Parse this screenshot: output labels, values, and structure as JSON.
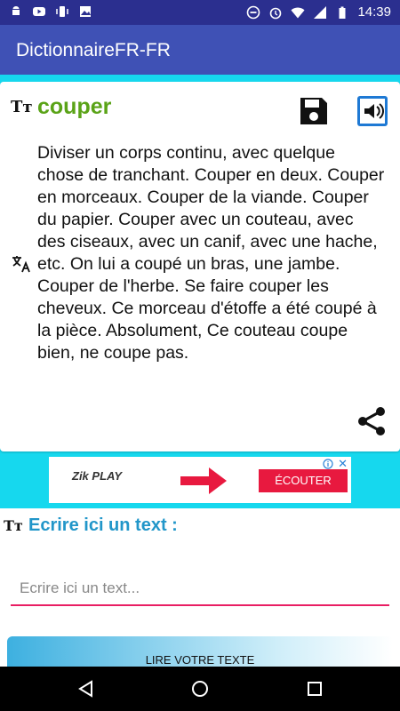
{
  "status_bar": {
    "time": "14:39",
    "left_icons": [
      "android-icon",
      "youtube-icon",
      "vibrate-icon",
      "image-icon"
    ],
    "right_icons": [
      "minus-circle-icon",
      "alarm-icon",
      "wifi-icon",
      "signal-icon",
      "battery-icon"
    ]
  },
  "app_bar": {
    "title": "DictionnaireFR-FR"
  },
  "entry": {
    "word": "couper",
    "definition": "Diviser un corps continu, avec quelque chose de tranchant. Couper en deux. Couper en morceaux. Couper de la viande. Couper du papier. Couper avec un couteau, avec des ciseaux, avec un canif, avec une hache, etc. On lui a coupé un bras, une jambe. Couper de l'herbe. Se faire couper les cheveux. Ce morceau d'étoffe a été coupé à la pièce. Absolument, Ce couteau coupe bien, ne coupe pas."
  },
  "ad": {
    "logo": "Zik PLAY",
    "button": "ÉCOUTER",
    "close": "✕"
  },
  "composer": {
    "label": "Ecrire ici un text :",
    "placeholder": "Ecrire ici un text...",
    "read_button": "LIRE VOTRE TEXTE"
  },
  "icons": {
    "text_size": "Tт",
    "save": "save-icon",
    "speaker": "speaker-icon",
    "translate": "translate-icon",
    "share": "share-icon"
  },
  "colors": {
    "status_bar": "#2b2f8f",
    "app_bar": "#3f51b5",
    "word": "#5aa317",
    "label": "#2196c9",
    "accent": "#e91e63",
    "background": "#16d8ee"
  }
}
